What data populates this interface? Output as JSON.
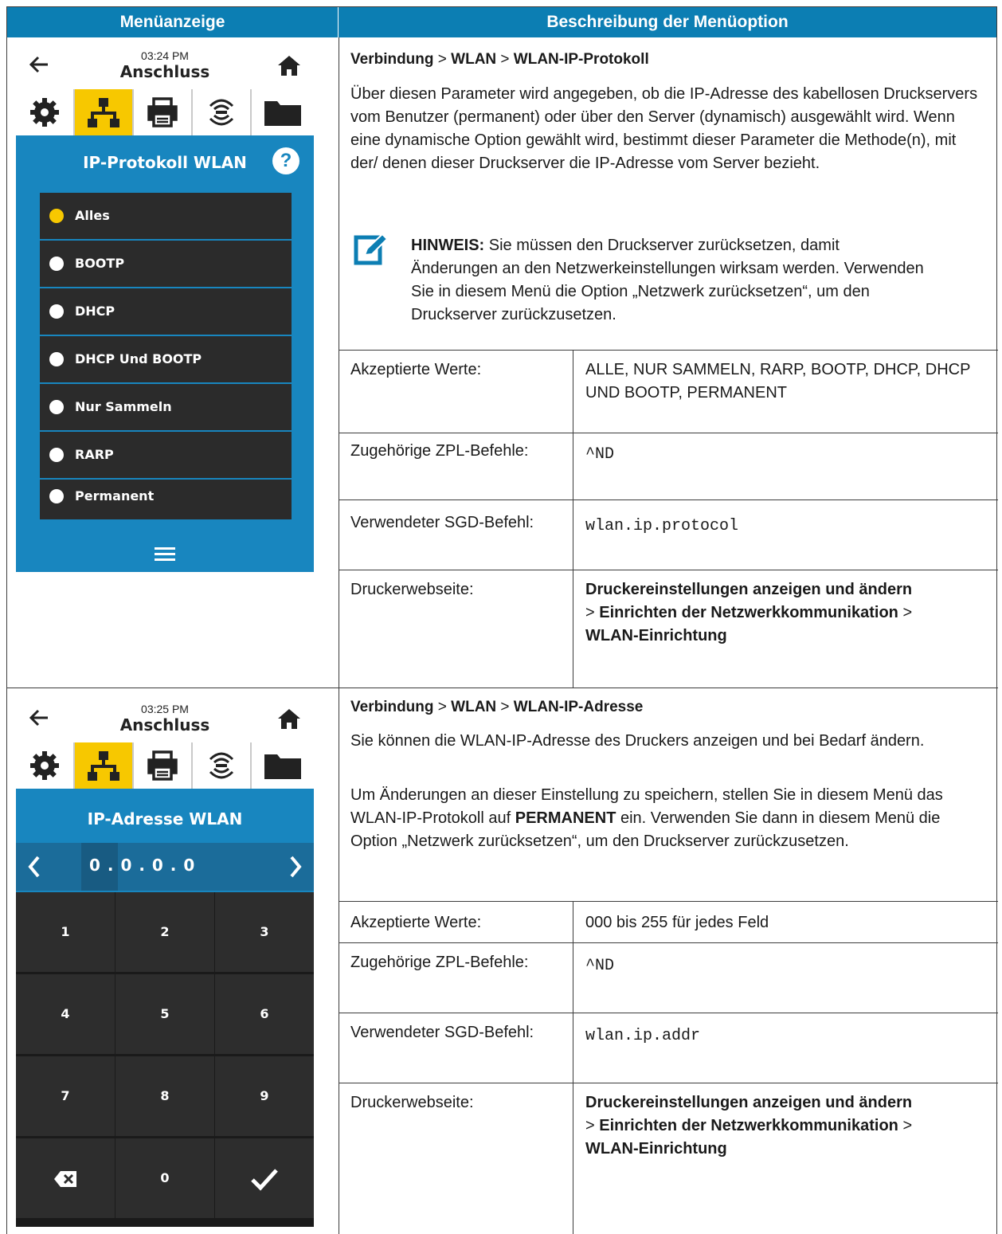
{
  "header": {
    "col1": "Menüanzeige",
    "col2": "Beschreibung der Menüoption"
  },
  "section1": {
    "screen": {
      "time": "03:24 PM",
      "title": "Anschluss",
      "heading": "IP-Protokoll WLAN",
      "help": "?",
      "options": [
        {
          "label": "Alles",
          "selected": true
        },
        {
          "label": "BOOTP",
          "selected": false
        },
        {
          "label": "DHCP",
          "selected": false
        },
        {
          "label": "DHCP Und BOOTP",
          "selected": false
        },
        {
          "label": "Nur Sammeln",
          "selected": false
        },
        {
          "label": "RARP",
          "selected": false
        },
        {
          "label": "Permanent",
          "selected": false
        }
      ]
    },
    "crumb": {
      "a": "Verbindung",
      "sep1": " > ",
      "b": "WLAN",
      "sep2": " > ",
      "c": "WLAN-IP-Protokoll"
    },
    "paragraph": "Über diesen Parameter wird angegeben, ob die IP-Adresse des kabellosen Druckservers vom Benutzer (permanent) oder über den Server (dynamisch) ausgewählt wird. Wenn eine dynamische Option gewählt wird, bestimmt dieser Parameter die Methode(n), mit der/ denen dieser Druckserver die IP-Adresse vom Server bezieht.",
    "note_label": "HINWEIS:",
    "note_text": " Sie müssen den Druckserver zurücksetzen, damit Änderungen an den Netzwerkeinstellungen wirksam werden. Verwenden Sie in diesem Menü die Option „Netzwerk zurücksetzen“, um den Druckserver zurückzusetzen.",
    "rows": {
      "accepted_label": "Akzeptierte Werte:",
      "accepted_value": "ALLE, NUR SAMMELN, RARP, BOOTP, DHCP, DHCP UND BOOTP, PERMANENT",
      "zpl_label": "Zugehörige ZPL-Befehle:",
      "zpl_value": "^ND",
      "sgd_label": "Verwendeter SGD-Befehl:",
      "sgd_value": "wlan.ip.protocol",
      "web_label": "Druckerwebseite:",
      "web_a": "Druckereinstellungen anzeigen und ändern",
      "web_sep": " > ",
      "web_b": "Einrichten der Netzwerkkommunikation",
      "web_sep2": " > ",
      "web_c": "WLAN-Einrichtung"
    }
  },
  "section2": {
    "screen": {
      "time": "03:25 PM",
      "title": "Anschluss",
      "heading": "IP-Adresse WLAN",
      "ip": "0 . 0 . 0 . 0",
      "keys": [
        "1",
        "2",
        "3",
        "4",
        "5",
        "6",
        "7",
        "8",
        "9",
        "backspace",
        "0",
        "check"
      ]
    },
    "crumb": {
      "a": "Verbindung",
      "sep1": " > ",
      "b": "WLAN",
      "sep2": " > ",
      "c": "WLAN-IP-Adresse"
    },
    "paragraph1": "Sie können die WLAN-IP-Adresse des Druckers anzeigen und bei Bedarf ändern.",
    "paragraph2_a": "Um Änderungen an dieser Einstellung zu speichern, stellen Sie in diesem Menü das WLAN-IP-Protokoll auf ",
    "paragraph2_b": "PERMANENT",
    "paragraph2_c": " ein. Verwenden Sie dann in diesem Menü die Option „Netzwerk zurücksetzen“, um den Druckserver zurückzusetzen.",
    "rows": {
      "accepted_label": "Akzeptierte Werte:",
      "accepted_value": "000 bis 255 für jedes Feld",
      "zpl_label": "Zugehörige ZPL-Befehle:",
      "zpl_value": "^ND",
      "sgd_label": "Verwendeter SGD-Befehl:",
      "sgd_value": "wlan.ip.addr",
      "web_label": "Druckerwebseite:",
      "web_a": "Druckereinstellungen anzeigen und ändern",
      "web_sep": " > ",
      "web_b": "Einrichten der Netzwerkkommunikation",
      "web_sep2": " > ",
      "web_c": "WLAN-Einrichtung"
    }
  },
  "icons": {
    "back": "back-arrow-icon",
    "home": "home-icon",
    "tabs": [
      "gear-icon",
      "network-icon",
      "printer-icon",
      "antenna-icon",
      "folder-icon"
    ],
    "note": "edit-note-icon",
    "menu": "hamburger-menu-icon",
    "accent": "#0c7eb3",
    "screen_blue": "#1886bf",
    "tab_active": "#f7c800"
  }
}
